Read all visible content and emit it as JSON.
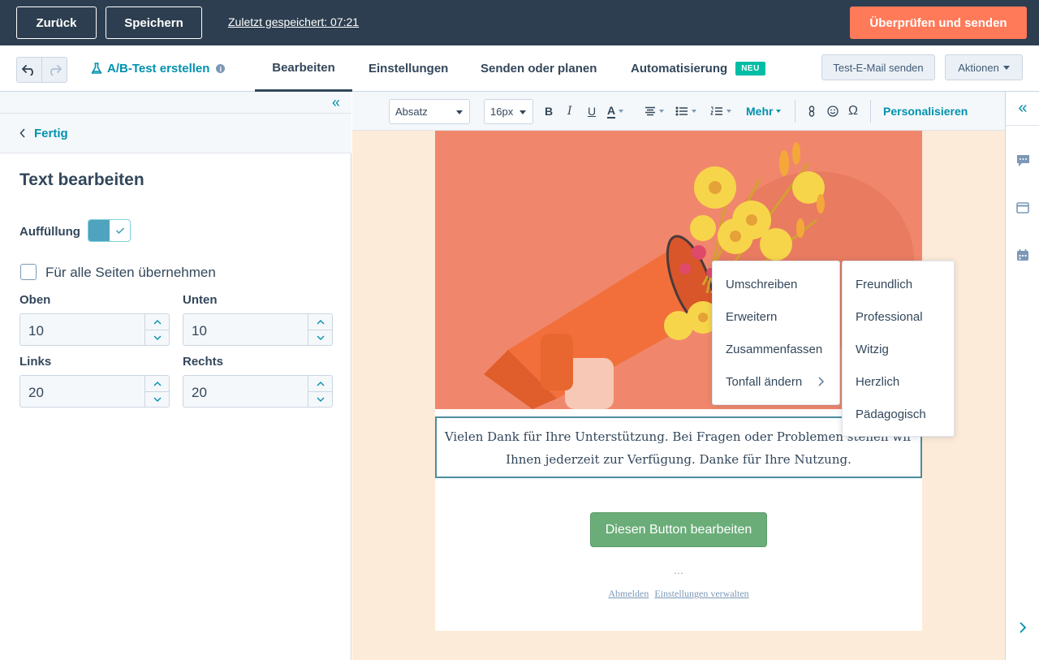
{
  "topbar": {
    "back_label": "Zurück",
    "save_label": "Speichern",
    "last_saved": "Zuletzt gespeichert: 07:21",
    "submit_label": "Überprüfen und senden"
  },
  "navrow": {
    "ab_test_label": "A/B-Test erstellen",
    "tabs": [
      {
        "label": "Bearbeiten",
        "active": true
      },
      {
        "label": "Einstellungen"
      },
      {
        "label": "Senden oder planen"
      },
      {
        "label": "Automatisierung",
        "badge": "NEU"
      }
    ],
    "test_email_label": "Test-E-Mail senden",
    "actions_label": "Aktionen"
  },
  "left_panel": {
    "back_link": "Fertig",
    "title": "Text bearbeiten",
    "padding_label": "Auffüllung",
    "padding_enabled": true,
    "apply_all_label": "Für alle Seiten übernehmen",
    "apply_all_checked": false,
    "fields": {
      "top": {
        "label": "Oben",
        "value": "10"
      },
      "bottom": {
        "label": "Unten",
        "value": "10"
      },
      "left": {
        "label": "Links",
        "value": "20"
      },
      "right": {
        "label": "Rechts",
        "value": "20"
      }
    }
  },
  "toolbar": {
    "block_style": "Absatz",
    "font_size": "16px",
    "more_label": "Mehr",
    "personalize_label": "Personalisieren"
  },
  "email": {
    "text_line1": "Vielen Dank für Ihre Unterstützung. Bei Fragen oder Problemen stehen wir",
    "text_line2": "Ihnen jederzeit zur Verfügung. Danke für Ihre Nutzung.",
    "button_label": "Diesen Button bearbeiten",
    "dots": "...",
    "unsubscribe": "Abmelden",
    "manage_prefs": "Einstellungen verwalten"
  },
  "ai_menu": {
    "items": [
      "Umschreiben",
      "Erweitern",
      "Zusammenfassen",
      "Tonfall ändern"
    ],
    "tone_items": [
      "Freundlich",
      "Professional",
      "Witzig",
      "Herzlich",
      "Pädagogisch"
    ]
  },
  "colors": {
    "topbar_bg": "#2d3e50",
    "accent_orange": "#ff7a59",
    "link_teal": "#0091ae",
    "badge_green": "#00bda5",
    "button_green": "#6aad78"
  }
}
